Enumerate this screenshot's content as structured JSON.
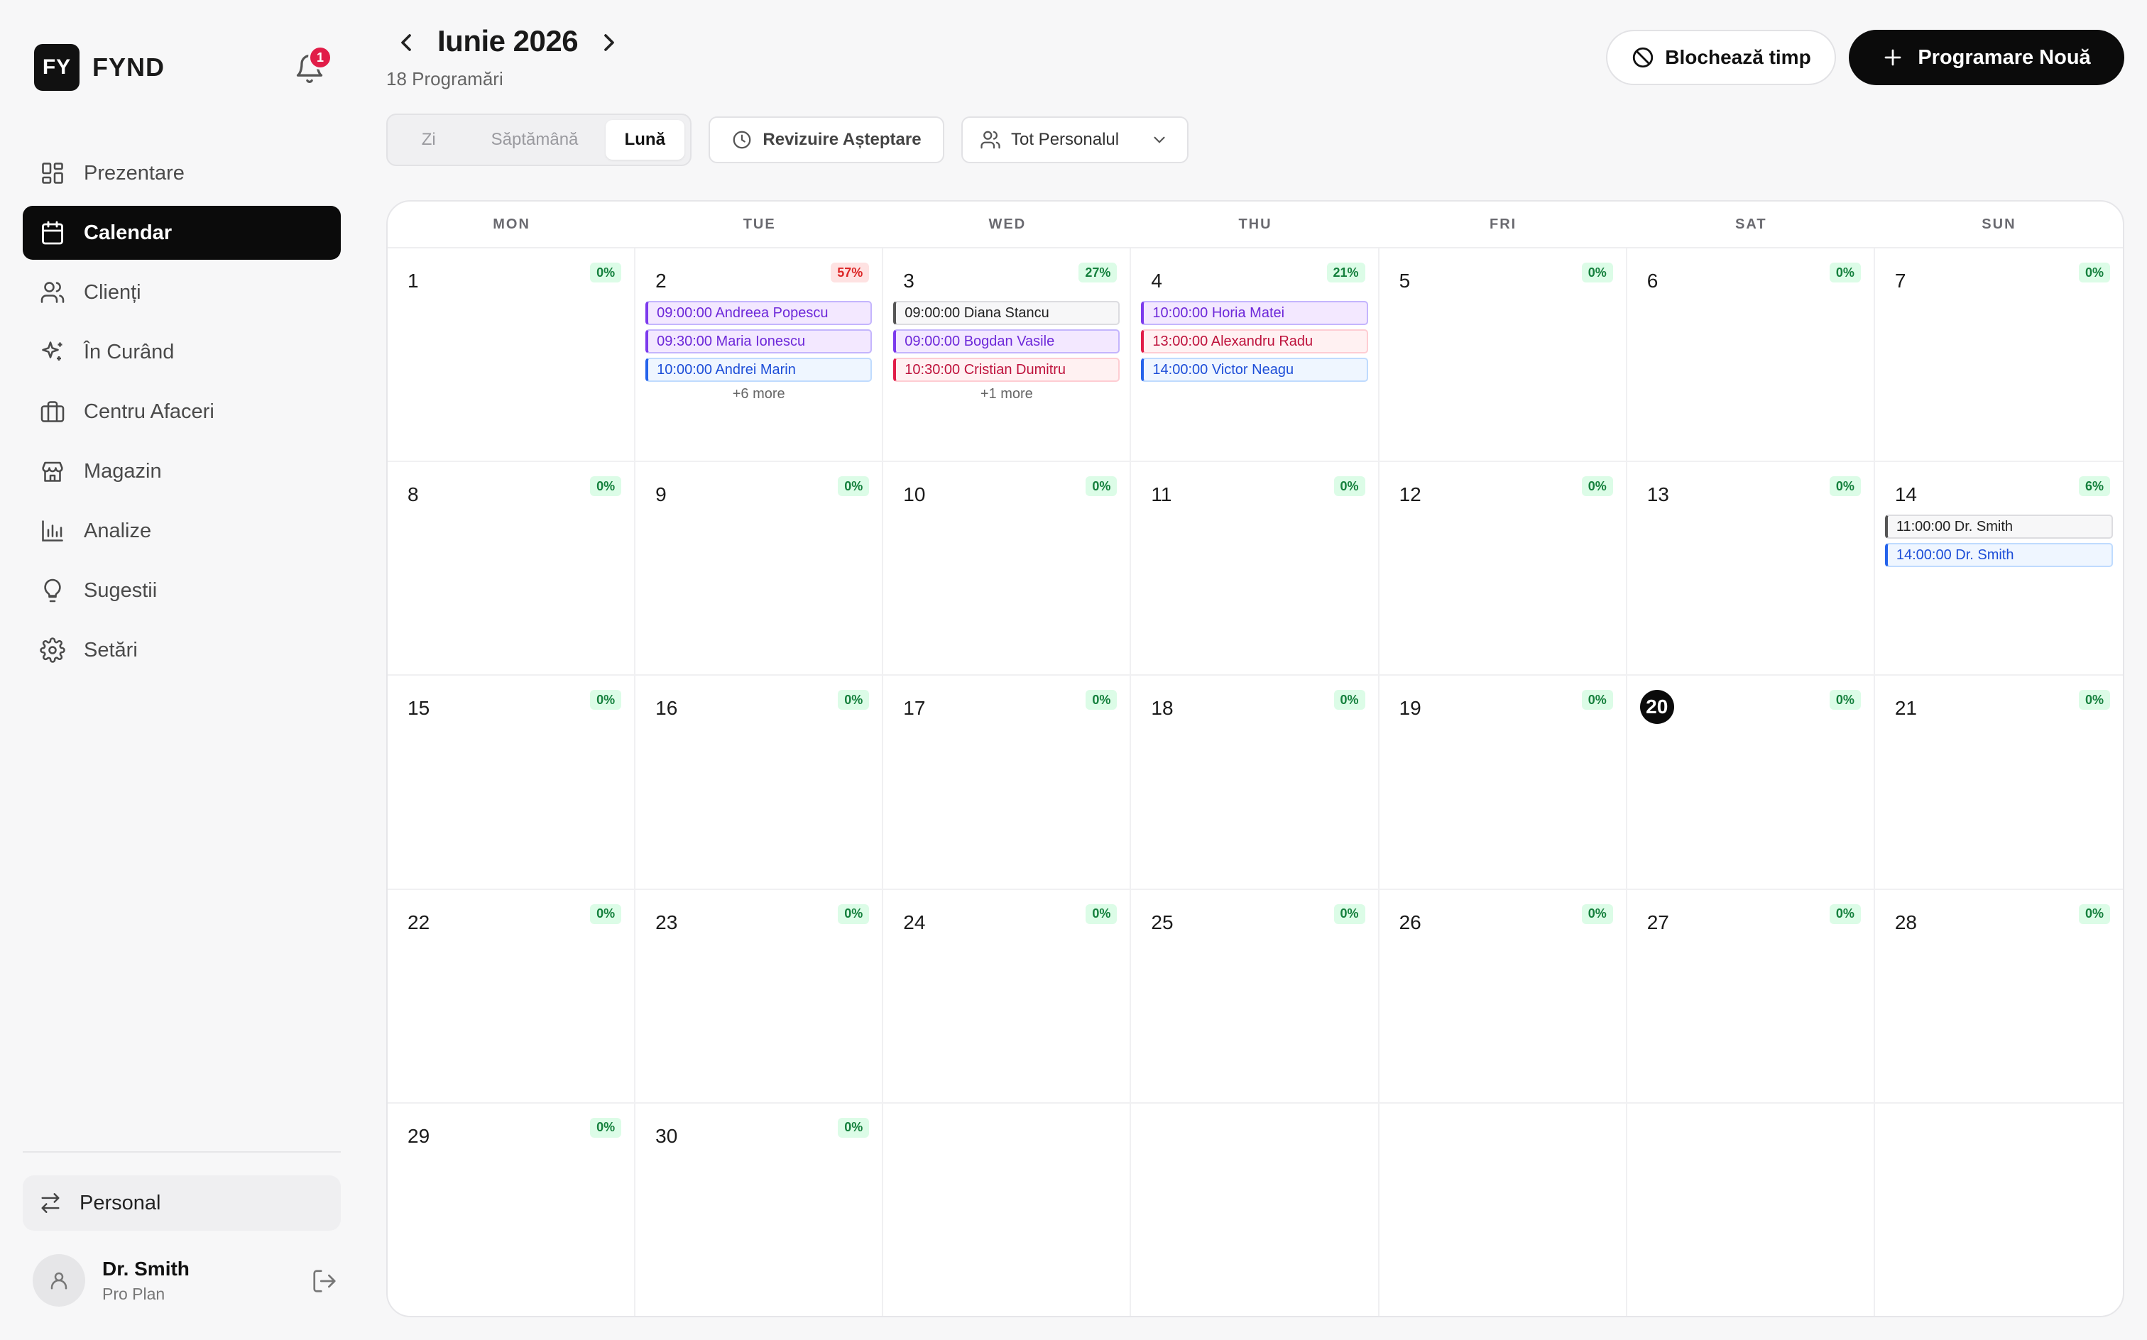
{
  "brand": {
    "logo": "FY",
    "name": "FYND"
  },
  "notifications": {
    "count": "1"
  },
  "nav": [
    {
      "label": "Prezentare",
      "icon": "dashboard-icon",
      "active": false
    },
    {
      "label": "Calendar",
      "icon": "calendar-icon",
      "active": true
    },
    {
      "label": "Clienți",
      "icon": "users-icon",
      "active": false
    },
    {
      "label": "În Curând",
      "icon": "sparkles-icon",
      "active": false
    },
    {
      "label": "Centru Afaceri",
      "icon": "briefcase-icon",
      "active": false
    },
    {
      "label": "Magazin",
      "icon": "store-icon",
      "active": false
    },
    {
      "label": "Analize",
      "icon": "bar-chart-icon",
      "active": false
    },
    {
      "label": "Sugestii",
      "icon": "lightbulb-icon",
      "active": false
    },
    {
      "label": "Setări",
      "icon": "gear-icon",
      "active": false
    }
  ],
  "sidebar_footer": {
    "switch_label": "Personal",
    "user_name": "Dr. Smith",
    "user_plan": "Pro Plan"
  },
  "header": {
    "month_title": "Iunie 2026",
    "appointment_count": "18 Programări",
    "block_time": "Blochează timp",
    "new_appointment": "Programare Nouă"
  },
  "toolbar": {
    "views": [
      "Zi",
      "Săptămână",
      "Lună"
    ],
    "active_view": "Lună",
    "review_waitlist": "Revizuire Așteptare",
    "staff_filter": "Tot Personalul"
  },
  "calendar": {
    "weekdays": [
      "MON",
      "TUE",
      "WED",
      "THU",
      "FRI",
      "SAT",
      "SUN"
    ],
    "today": "20",
    "days": [
      {
        "day": "1",
        "occ": "0%",
        "level": "green",
        "events": [],
        "more": ""
      },
      {
        "day": "2",
        "occ": "57%",
        "level": "red",
        "events": [
          {
            "text": "09:00:00 Andreea Popescu",
            "color": "purple"
          },
          {
            "text": "09:30:00 Maria Ionescu",
            "color": "purple"
          },
          {
            "text": "10:00:00 Andrei Marin",
            "color": "blue"
          }
        ],
        "more": "+6 more"
      },
      {
        "day": "3",
        "occ": "27%",
        "level": "green",
        "events": [
          {
            "text": "09:00:00 Diana Stancu",
            "color": "gray"
          },
          {
            "text": "09:00:00 Bogdan Vasile",
            "color": "purple"
          },
          {
            "text": "10:30:00 Cristian Dumitru",
            "color": "red"
          }
        ],
        "more": "+1 more"
      },
      {
        "day": "4",
        "occ": "21%",
        "level": "green",
        "events": [
          {
            "text": "10:00:00 Horia Matei",
            "color": "purple"
          },
          {
            "text": "13:00:00 Alexandru Radu",
            "color": "red"
          },
          {
            "text": "14:00:00 Victor Neagu",
            "color": "blue"
          }
        ],
        "more": ""
      },
      {
        "day": "5",
        "occ": "0%",
        "level": "green",
        "events": [],
        "more": ""
      },
      {
        "day": "6",
        "occ": "0%",
        "level": "green",
        "events": [],
        "more": ""
      },
      {
        "day": "7",
        "occ": "0%",
        "level": "green",
        "events": [],
        "more": ""
      },
      {
        "day": "8",
        "occ": "0%",
        "level": "green",
        "events": [],
        "more": ""
      },
      {
        "day": "9",
        "occ": "0%",
        "level": "green",
        "events": [],
        "more": ""
      },
      {
        "day": "10",
        "occ": "0%",
        "level": "green",
        "events": [],
        "more": ""
      },
      {
        "day": "11",
        "occ": "0%",
        "level": "green",
        "events": [],
        "more": ""
      },
      {
        "day": "12",
        "occ": "0%",
        "level": "green",
        "events": [],
        "more": ""
      },
      {
        "day": "13",
        "occ": "0%",
        "level": "green",
        "events": [],
        "more": ""
      },
      {
        "day": "14",
        "occ": "6%",
        "level": "green",
        "events": [
          {
            "text": "11:00:00 Dr. Smith",
            "color": "gray"
          },
          {
            "text": "14:00:00 Dr. Smith",
            "color": "blue"
          }
        ],
        "more": ""
      },
      {
        "day": "15",
        "occ": "0%",
        "level": "green",
        "events": [],
        "more": ""
      },
      {
        "day": "16",
        "occ": "0%",
        "level": "green",
        "events": [],
        "more": ""
      },
      {
        "day": "17",
        "occ": "0%",
        "level": "green",
        "events": [],
        "more": ""
      },
      {
        "day": "18",
        "occ": "0%",
        "level": "green",
        "events": [],
        "more": ""
      },
      {
        "day": "19",
        "occ": "0%",
        "level": "green",
        "events": [],
        "more": ""
      },
      {
        "day": "20",
        "occ": "0%",
        "level": "green",
        "events": [],
        "more": ""
      },
      {
        "day": "21",
        "occ": "0%",
        "level": "green",
        "events": [],
        "more": ""
      },
      {
        "day": "22",
        "occ": "0%",
        "level": "green",
        "events": [],
        "more": ""
      },
      {
        "day": "23",
        "occ": "0%",
        "level": "green",
        "events": [],
        "more": ""
      },
      {
        "day": "24",
        "occ": "0%",
        "level": "green",
        "events": [],
        "more": ""
      },
      {
        "day": "25",
        "occ": "0%",
        "level": "green",
        "events": [],
        "more": ""
      },
      {
        "day": "26",
        "occ": "0%",
        "level": "green",
        "events": [],
        "more": ""
      },
      {
        "day": "27",
        "occ": "0%",
        "level": "green",
        "events": [],
        "more": ""
      },
      {
        "day": "28",
        "occ": "0%",
        "level": "green",
        "events": [],
        "more": ""
      },
      {
        "day": "29",
        "occ": "0%",
        "level": "green",
        "events": [],
        "more": ""
      },
      {
        "day": "30",
        "occ": "0%",
        "level": "green",
        "events": [],
        "more": ""
      },
      {
        "day": "",
        "occ": "",
        "level": "",
        "events": [],
        "more": ""
      },
      {
        "day": "",
        "occ": "",
        "level": "",
        "events": [],
        "more": ""
      },
      {
        "day": "",
        "occ": "",
        "level": "",
        "events": [],
        "more": ""
      },
      {
        "day": "",
        "occ": "",
        "level": "",
        "events": [],
        "more": ""
      },
      {
        "day": "",
        "occ": "",
        "level": "",
        "events": [],
        "more": ""
      }
    ]
  }
}
